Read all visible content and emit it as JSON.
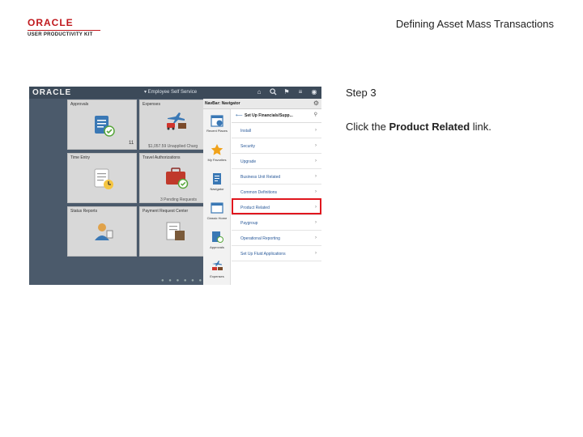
{
  "header": {
    "logo_brand": "ORACLE",
    "logo_product": "USER PRODUCTIVITY KIT",
    "doc_title": "Defining Asset Mass Transactions"
  },
  "instructions": {
    "step": "Step 3",
    "text_prefix": "Click the ",
    "link_name": "Product Related",
    "text_suffix": " link."
  },
  "app": {
    "logo": "ORACLE",
    "title": "▾ Employee Self Service",
    "top_icons": [
      "home-icon",
      "search-icon",
      "flag-icon",
      "menu-icon",
      "compass-icon"
    ],
    "tiles": [
      {
        "label": "Approvals",
        "icon": "clipboard-check-icon"
      },
      {
        "label": "Expenses",
        "icon": "travel-icon",
        "sub": "$1,057.59 Unapplied Charg",
        "count": "11"
      },
      {
        "label": "Time Entry",
        "icon": "timesheet-icon"
      },
      {
        "label": "Travel Authorizations",
        "icon": "briefcase-icon",
        "sub": "3 Pending Requests"
      },
      {
        "label": "Status Reports",
        "icon": "person-report-icon"
      },
      {
        "label": "Payment Request Center",
        "icon": "payment-icon"
      }
    ],
    "navbar": {
      "title": "NavBar: Navigator",
      "side": [
        {
          "label": "Recent Places",
          "icon": "calendar-icon"
        },
        {
          "label": "My Favorites",
          "icon": "star-icon"
        },
        {
          "label": "Navigator",
          "icon": "document-icon"
        },
        {
          "label": "Classic Home",
          "icon": "window-icon"
        },
        {
          "label": "Approvals",
          "icon": "approvals-icon"
        },
        {
          "label": "Expenses",
          "icon": "expenses-icon"
        }
      ],
      "breadcrumb": "Set Up Financials/Supp...",
      "items": [
        {
          "label": "Install"
        },
        {
          "label": "Security"
        },
        {
          "label": "Upgrade"
        },
        {
          "label": "Business Unit Related"
        },
        {
          "label": "Common Definitions"
        },
        {
          "label": "Product Related"
        },
        {
          "label": "Paygroup"
        },
        {
          "label": "Operational Reporting"
        },
        {
          "label": "Set Up Fluid Applications"
        }
      ]
    }
  }
}
